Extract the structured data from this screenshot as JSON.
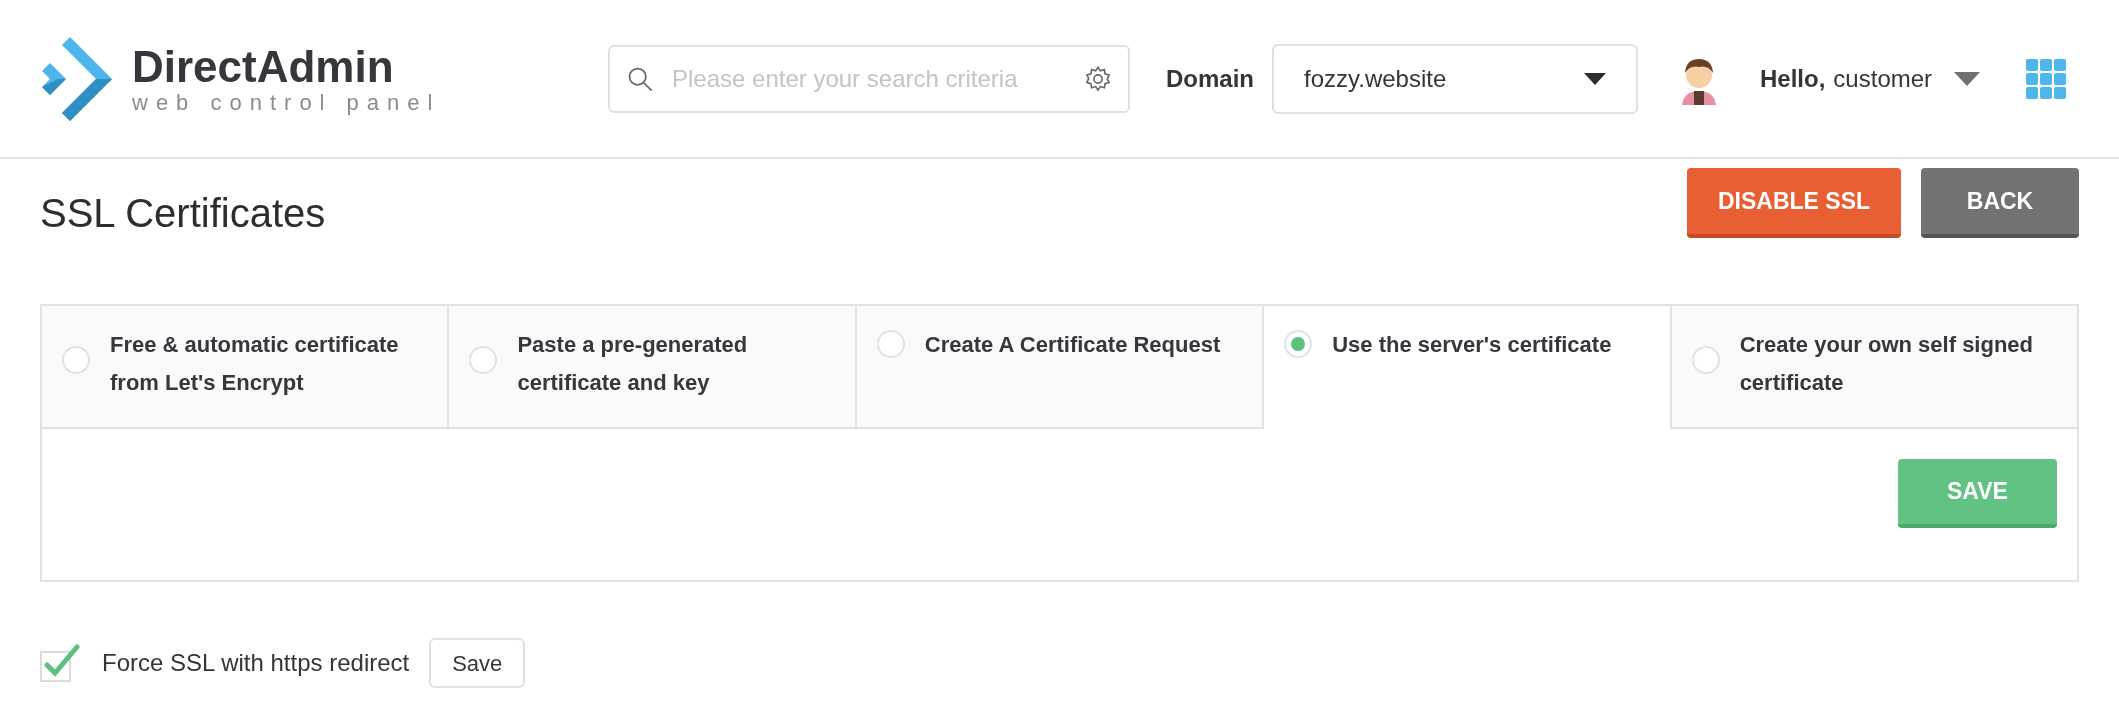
{
  "header": {
    "logo": {
      "title": "DirectAdmin",
      "subtitle": "web control panel"
    },
    "search": {
      "placeholder": "Please enter your search criteria"
    },
    "domain": {
      "label": "Domain",
      "value": "fozzy.website"
    },
    "user": {
      "greeting": "Hello,",
      "name": "customer"
    }
  },
  "page": {
    "title": "SSL Certificates",
    "buttons": [
      {
        "label": "DISABLE SSL",
        "kind": "danger"
      },
      {
        "label": "BACK",
        "kind": "neutral"
      }
    ]
  },
  "options": [
    {
      "label": "Free & automatic certificate from Let's Encrypt",
      "selected": false
    },
    {
      "label": "Paste a pre-generated certificate and key",
      "selected": false
    },
    {
      "label": "Create A Certificate Request",
      "selected": false
    },
    {
      "label": "Use the server's certificate",
      "selected": true
    },
    {
      "label": "Create your own self signed certificate",
      "selected": false
    }
  ],
  "save_button": "SAVE",
  "force_ssl": {
    "label": "Force SSL with https redirect",
    "checked": true,
    "button": "Save"
  }
}
